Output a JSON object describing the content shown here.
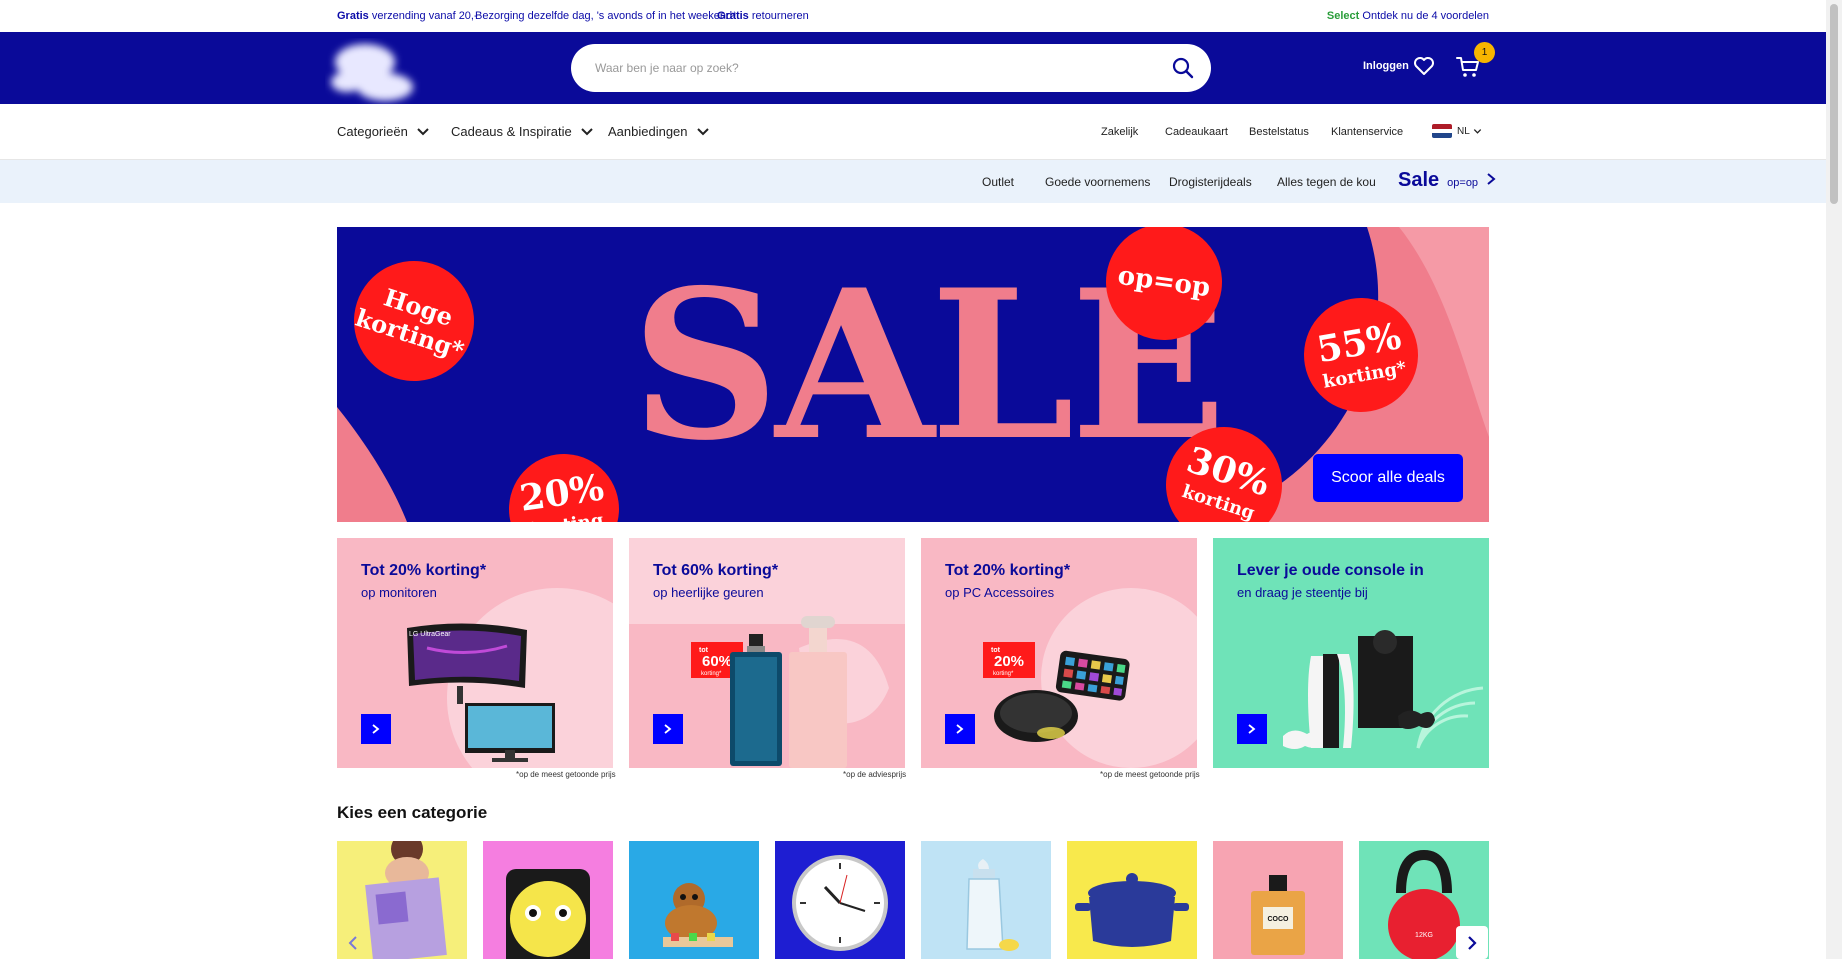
{
  "usp": {
    "items": [
      {
        "bold": "Gratis",
        "text": " verzending vanaf 20,-"
      },
      {
        "bold": "",
        "text": "Bezorging dezelfde dag, 's avonds of in het weekend*"
      },
      {
        "bold": "Gratis",
        "text": " retourneren"
      }
    ],
    "select_bold": "Select",
    "select_text": " Ontdek nu de 4 voordelen"
  },
  "header": {
    "search_placeholder": "Waar ben je naar op zoek?",
    "login_label": "Inloggen",
    "cart_count": "1"
  },
  "nav": {
    "main": [
      "Categorieën",
      "Cadeaus & Inspiratie",
      "Aanbiedingen"
    ],
    "secondary": [
      "Zakelijk",
      "Cadeaukaart",
      "Bestelstatus",
      "Klantenservice"
    ],
    "language": "NL"
  },
  "subnav": {
    "items": [
      "Outlet",
      "Goede voornemens",
      "Drogisterijdeals",
      "Alles tegen de kou"
    ],
    "sale_label": "Sale",
    "sale_sub": "op=op"
  },
  "hero": {
    "headline": "SALE",
    "badge_1_line1": "Hoge",
    "badge_1_line2": "korting*",
    "badge_2": "op=op",
    "badge_3_big": "55%",
    "badge_3_small": "korting*",
    "badge_4_big": "20%",
    "badge_4_small": "korting",
    "badge_5_big": "30%",
    "badge_5_small": "korting",
    "cta_label": "Scoor alle deals"
  },
  "promos": [
    {
      "title": "Tot 20% korting*",
      "subtitle": "op monitoren",
      "note": "*op de meest getoonde prijs",
      "bg": "#f9b8c4",
      "brand_text": "LG UltraGear"
    },
    {
      "title": "Tot 60% korting*",
      "subtitle": "op heerlijke geuren",
      "note": "*op de adviesprijs",
      "bg": "#fbd2da",
      "sticker_top": "tot",
      "sticker_big": "60%",
      "sticker_bottom": "korting*"
    },
    {
      "title": "Tot 20% korting*",
      "subtitle": "op PC Accessoires",
      "note": "*op de meest getoonde prijs",
      "bg": "#f9b8c4",
      "sticker_top": "tot",
      "sticker_big": "20%",
      "sticker_bottom": "korting*"
    },
    {
      "title": "Lever je oude console in",
      "subtitle": "en draag je steentje bij",
      "note": "",
      "bg": "#6fe3b8"
    }
  ],
  "categories": {
    "title": "Kies een categorie",
    "items": [
      {
        "icon": "book-reader",
        "bg": "#f6ef7a"
      },
      {
        "icon": "power-socket",
        "bg": "#f57ee0"
      },
      {
        "icon": "toy-monkey",
        "bg": "#29a9e6"
      },
      {
        "icon": "wall-clock",
        "bg": "#1e1ed2"
      },
      {
        "icon": "baby-bottle",
        "bg": "#bfe3f5"
      },
      {
        "icon": "casserole-pan",
        "bg": "#f8e94c"
      },
      {
        "icon": "perfume-bottle",
        "bg": "#f7a4b2"
      },
      {
        "icon": "kettlebell",
        "bg": "#6fe3b8"
      }
    ],
    "kettlebell_label": "12KG",
    "perfume_label": "COCO"
  },
  "colors": {
    "brand_blue": "#0a0a99",
    "cta_blue": "#0000ff",
    "sale_pink": "#f07d8c",
    "badge_red": "#ff1a1a",
    "cart_badge": "#f7b500"
  }
}
